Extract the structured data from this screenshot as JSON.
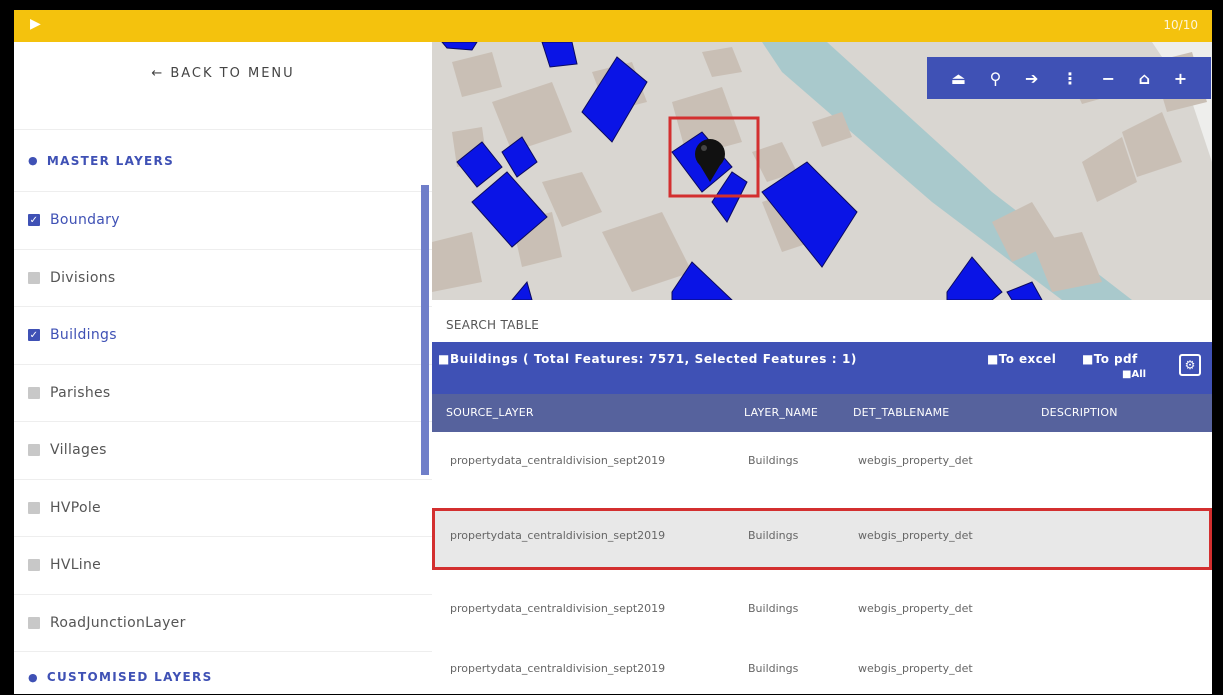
{
  "topbar": {
    "play_icon": "play-icon",
    "page": "10/10"
  },
  "sidebar": {
    "back_label": "← BACK TO MENU",
    "master_header": "MASTER LAYERS",
    "layers": [
      {
        "label": "Boundary",
        "checked": true
      },
      {
        "label": "Divisions",
        "checked": false
      },
      {
        "label": "Buildings",
        "checked": true
      },
      {
        "label": "Parishes",
        "checked": false
      },
      {
        "label": "Villages",
        "checked": false
      },
      {
        "label": "HVPole",
        "checked": false
      },
      {
        "label": "HVLine",
        "checked": false
      },
      {
        "label": "RoadJunctionLayer",
        "checked": false
      }
    ],
    "custom_header": "CUSTOMISED LAYERS"
  },
  "map": {
    "tools": [
      "eraser-icon",
      "marker-icon",
      "exit-icon",
      "more-icon",
      "zoom-out-icon",
      "home-icon",
      "zoom-in-icon"
    ],
    "tool_glyphs": [
      "⏏",
      "⚲",
      "➔",
      "⋮",
      "−",
      "⌂",
      "+"
    ],
    "accent": "#3f51b5",
    "building_color": "#0a14e6",
    "highlight_color": "#d32f2f"
  },
  "search": {
    "placeholder": "SEARCH TABLE"
  },
  "table": {
    "title": "Buildings ( Total Features: 7571, Selected Features : 1)",
    "excel_label": "To excel",
    "pdf_label": "To pdf",
    "all_label": "All",
    "columns": [
      "SOURCE_LAYER",
      "LAYER_NAME",
      "DET_TABLENAME",
      "DESCRIPTION"
    ],
    "rows": [
      [
        "propertydata_centraldivision_sept2019",
        "Buildings",
        "webgis_property_det",
        ""
      ],
      [
        "propertydata_centraldivision_sept2019",
        "Buildings",
        "webgis_property_det",
        ""
      ],
      [
        "propertydata_centraldivision_sept2019",
        "Buildings",
        "webgis_property_det",
        ""
      ],
      [
        "propertydata_centraldivision_sept2019",
        "Buildings",
        "webgis_property_det",
        ""
      ]
    ],
    "selected_row": 2
  }
}
